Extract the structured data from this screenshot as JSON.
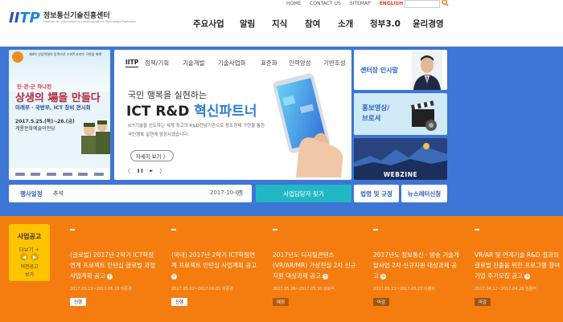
{
  "header": {
    "logo_mark_i": "II",
    "logo_mark_tp": "TP",
    "logo_name_ko": "정보통신기술진흥센터",
    "logo_name_en": "Institute for Information & communications Technology Promotion",
    "util_links": [
      "HOME",
      "CONTACT US",
      "SITEMAP",
      "ENGLISH"
    ],
    "nav": [
      "주요사업",
      "알림",
      "지식",
      "참여",
      "소개",
      "정부3.0",
      "윤리경영"
    ]
  },
  "banner_left": {
    "small": "제4차 산업혁명의 동력으로 스마트코리아 구현을 위해",
    "mid": "민·관·군 하나된",
    "big": "상생의 場을 만들다",
    "gov": "미래부 · 국방부, ICT 장비 전시회",
    "date": "2017.5.25.(목)~26.(금)",
    "venue": "계룡문화예술의전당"
  },
  "main_panel": {
    "tabs": [
      "IITP",
      "정책/기획",
      "기술개발",
      "기술사업화",
      "표준화",
      "인력양성",
      "기반조성"
    ],
    "headline1": "국민 행복을 실현하는",
    "headline2_a": "ICT R&D ",
    "headline2_b": "혁신파트너",
    "desc": "ICT기술을 선도하는 세계 최고의 R&D전담기관으로 창조경제 구현을 통한 국민행복 실현에 앞장서겠습니다.",
    "more": "자세히 보기 〉",
    "pager": [
      "〈",
      "❚❚",
      "▶",
      "〉"
    ]
  },
  "tiles": {
    "ceo": "센터장 인사말",
    "promo_line1": "홍보영상/",
    "promo_line2": "브로셔",
    "webzine": "WEBZINE"
  },
  "event_bar": {
    "label": "행사일정",
    "text": "추석",
    "date": "2017-10-06",
    "up": "︿",
    "down": "﹀"
  },
  "quick_buttons": {
    "find": "사업담당자 찾기",
    "law": "법령 및 규정",
    "newsletter": "뉴스레터신청"
  },
  "notice_box": {
    "title": "사업공고",
    "more": "더보기 +",
    "prev_line1": "이전공고",
    "prev_line2": "보기"
  },
  "notices": [
    {
      "title": "(글로벌) 2017년 2학기 ICT학점연계 프로젝트 인턴십 글로벌 과정 사업계획 공고",
      "meta": "2017.05.19~2017.06.19 이준경",
      "status": "진행"
    },
    {
      "title": "(국내) 2017년 2학기 ICT학점연계 프로젝트 인턴십 사업계획 공고",
      "meta": "2017.05.02~2017.06.01 이준경",
      "status": "진행"
    },
    {
      "title": "2017년도 디지털콘텐츠(VR/AR/MR) 가상현실 2차 신규지원 대상과제 공고",
      "meta": "2017.05.26~2017.05.30 강효석",
      "status": "예정"
    },
    {
      "title": "2017년도 정보통신 · 방송 기술개발사업 2차 신규지원 대상과제 공고",
      "meta": "2017.05.11~2017.05.22 이병화",
      "status": "마감"
    },
    {
      "title": "VR/AR 및 연계기술 R&D 결과의 글로벌 진출을 위한 프로그램 참여기업 추가모집 공고",
      "meta": "2017.04.12~2017.04.28 임종석",
      "status": "마감"
    }
  ]
}
